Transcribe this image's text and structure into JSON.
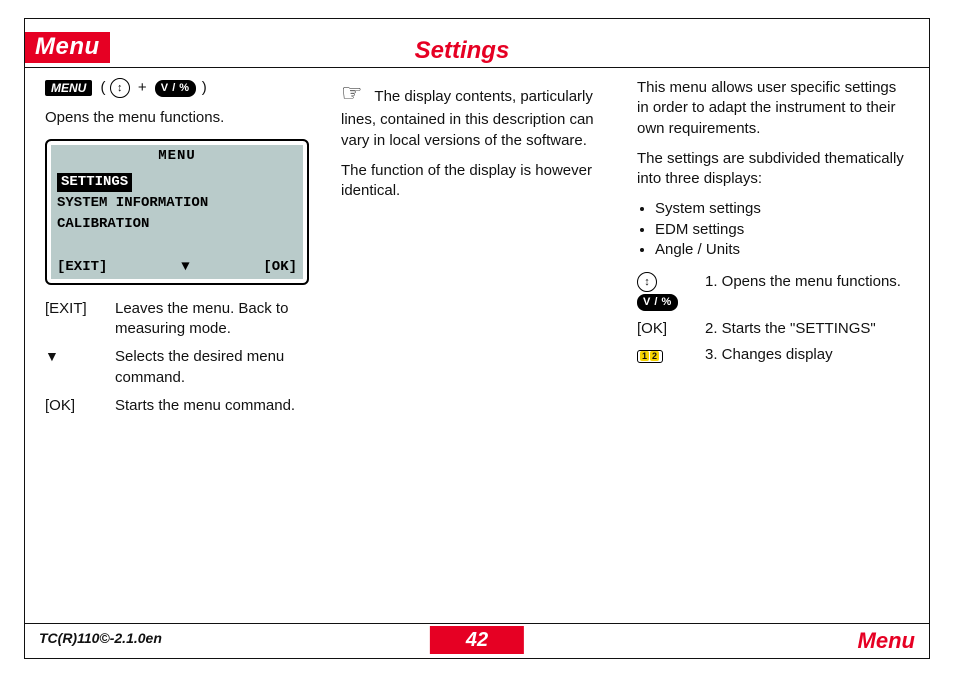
{
  "header": {
    "menu_title": "Menu",
    "settings_title": "Settings"
  },
  "col1": {
    "key_label": "MENU",
    "updn_glyph": "↕",
    "plus": "+",
    "vpct": "V / %",
    "open_paren": "(",
    "close_paren": ")",
    "intro": "Opens the menu functions.",
    "lcd": {
      "title": "MENU",
      "selected": "SETTINGS",
      "line2": "SYSTEM INFORMATION",
      "line3": "CALIBRATION",
      "exit": "[EXIT]",
      "ok": "[OK]",
      "arrow": "▼"
    },
    "defs": {
      "exit_term": "[EXIT]",
      "exit_desc": "Leaves the menu. Back to measuring mode.",
      "down_term": "▼",
      "down_desc": "Selects the desired menu command.",
      "ok_term": "[OK]",
      "ok_desc": "Starts the menu command."
    }
  },
  "col2": {
    "p1": "The display contents, particularly lines, contained in this description can vary in local versions of the software.",
    "p2": "The function of the display is however identical."
  },
  "col3": {
    "p1": "This menu allows user specific settings in order to adapt the instrument to their own requirements.",
    "p2": "The settings are subdivided thematically into three displays:",
    "bullets": [
      "System settings",
      "EDM settings",
      "Angle / Units"
    ],
    "actions": {
      "vpct": "V / %",
      "a1": "1. Opens the menu functions.",
      "ok_term": "[OK]",
      "a2": "2. Starts the \"SETTINGS\"",
      "pg_glyph_1": "1",
      "pg_glyph_2": "2",
      "a3": "3. Changes display"
    }
  },
  "footer": {
    "left": "TC(R)110©-2.1.0en",
    "page": "42",
    "right": "Menu"
  }
}
